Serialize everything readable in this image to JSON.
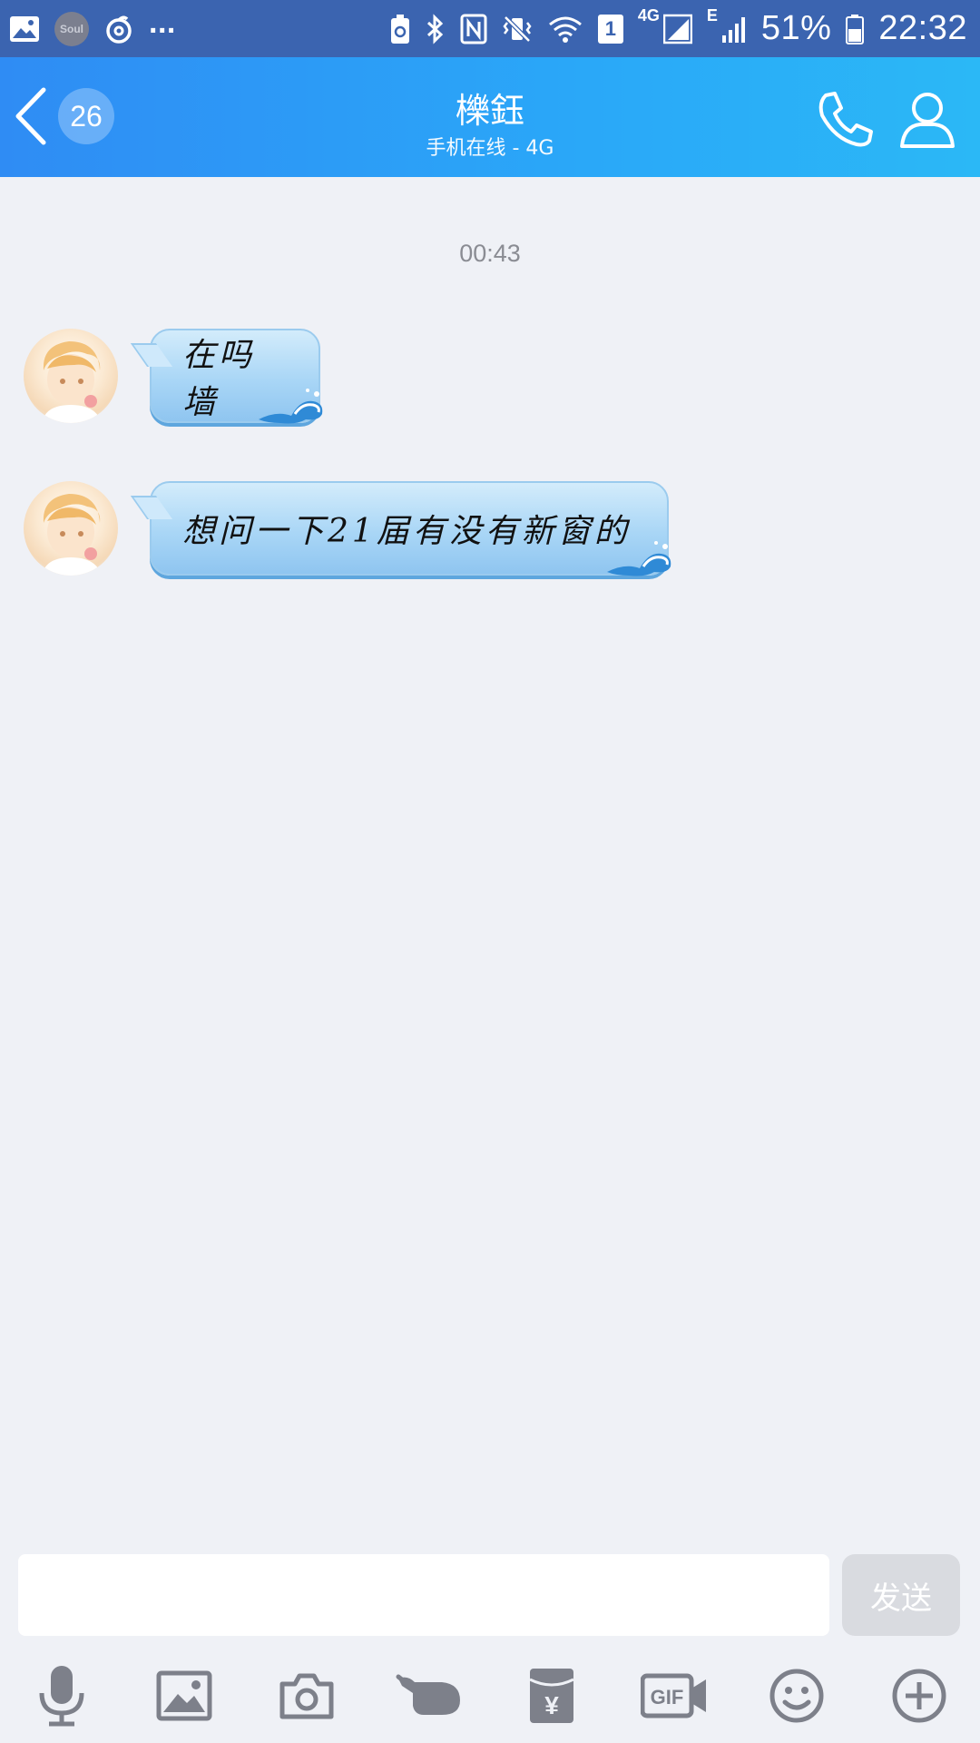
{
  "status_bar": {
    "soul_label": "Soul",
    "ellipsis": "...",
    "sim_badge": "1",
    "net_4g": "4G",
    "net_e": "E",
    "battery": "51%",
    "time": "22:32"
  },
  "header": {
    "back_badge": "26",
    "title": "櫟鈺",
    "subtitle": "手机在线 - 4G"
  },
  "chat": {
    "timestamp": "00:43",
    "messages": [
      {
        "text": "在吗墙"
      },
      {
        "text": "想问一下21届有没有新窗的"
      }
    ]
  },
  "composer": {
    "input_value": "",
    "send_label": "发送"
  },
  "toolbar": {
    "gif_label": "GIF",
    "yen_label": "¥",
    "items": [
      "mic-icon",
      "image-icon",
      "camera-icon",
      "poke-icon",
      "red-packet-icon",
      "gif-video-icon",
      "emoji-icon",
      "plus-icon"
    ]
  },
  "colors": {
    "status_bar": "#3b64b0",
    "header_start": "#2f8cf4",
    "header_end": "#2bb8f6",
    "background": "#eff1f6",
    "bubble": "#a9d6f6",
    "icon_gray": "#7d808a"
  }
}
